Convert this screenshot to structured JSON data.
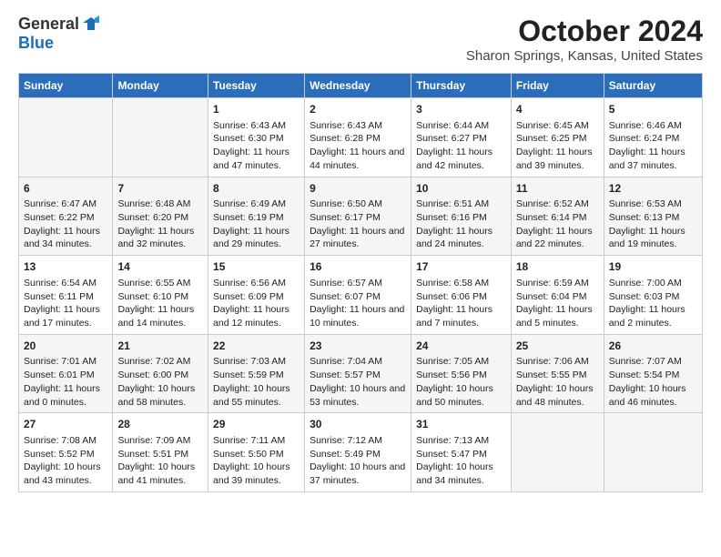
{
  "header": {
    "logo_general": "General",
    "logo_blue": "Blue",
    "month": "October 2024",
    "location": "Sharon Springs, Kansas, United States"
  },
  "days_of_week": [
    "Sunday",
    "Monday",
    "Tuesday",
    "Wednesday",
    "Thursday",
    "Friday",
    "Saturday"
  ],
  "weeks": [
    [
      {
        "day": "",
        "info": ""
      },
      {
        "day": "",
        "info": ""
      },
      {
        "day": "1",
        "info": "Sunrise: 6:43 AM\nSunset: 6:30 PM\nDaylight: 11 hours and 47 minutes."
      },
      {
        "day": "2",
        "info": "Sunrise: 6:43 AM\nSunset: 6:28 PM\nDaylight: 11 hours and 44 minutes."
      },
      {
        "day": "3",
        "info": "Sunrise: 6:44 AM\nSunset: 6:27 PM\nDaylight: 11 hours and 42 minutes."
      },
      {
        "day": "4",
        "info": "Sunrise: 6:45 AM\nSunset: 6:25 PM\nDaylight: 11 hours and 39 minutes."
      },
      {
        "day": "5",
        "info": "Sunrise: 6:46 AM\nSunset: 6:24 PM\nDaylight: 11 hours and 37 minutes."
      }
    ],
    [
      {
        "day": "6",
        "info": "Sunrise: 6:47 AM\nSunset: 6:22 PM\nDaylight: 11 hours and 34 minutes."
      },
      {
        "day": "7",
        "info": "Sunrise: 6:48 AM\nSunset: 6:20 PM\nDaylight: 11 hours and 32 minutes."
      },
      {
        "day": "8",
        "info": "Sunrise: 6:49 AM\nSunset: 6:19 PM\nDaylight: 11 hours and 29 minutes."
      },
      {
        "day": "9",
        "info": "Sunrise: 6:50 AM\nSunset: 6:17 PM\nDaylight: 11 hours and 27 minutes."
      },
      {
        "day": "10",
        "info": "Sunrise: 6:51 AM\nSunset: 6:16 PM\nDaylight: 11 hours and 24 minutes."
      },
      {
        "day": "11",
        "info": "Sunrise: 6:52 AM\nSunset: 6:14 PM\nDaylight: 11 hours and 22 minutes."
      },
      {
        "day": "12",
        "info": "Sunrise: 6:53 AM\nSunset: 6:13 PM\nDaylight: 11 hours and 19 minutes."
      }
    ],
    [
      {
        "day": "13",
        "info": "Sunrise: 6:54 AM\nSunset: 6:11 PM\nDaylight: 11 hours and 17 minutes."
      },
      {
        "day": "14",
        "info": "Sunrise: 6:55 AM\nSunset: 6:10 PM\nDaylight: 11 hours and 14 minutes."
      },
      {
        "day": "15",
        "info": "Sunrise: 6:56 AM\nSunset: 6:09 PM\nDaylight: 11 hours and 12 minutes."
      },
      {
        "day": "16",
        "info": "Sunrise: 6:57 AM\nSunset: 6:07 PM\nDaylight: 11 hours and 10 minutes."
      },
      {
        "day": "17",
        "info": "Sunrise: 6:58 AM\nSunset: 6:06 PM\nDaylight: 11 hours and 7 minutes."
      },
      {
        "day": "18",
        "info": "Sunrise: 6:59 AM\nSunset: 6:04 PM\nDaylight: 11 hours and 5 minutes."
      },
      {
        "day": "19",
        "info": "Sunrise: 7:00 AM\nSunset: 6:03 PM\nDaylight: 11 hours and 2 minutes."
      }
    ],
    [
      {
        "day": "20",
        "info": "Sunrise: 7:01 AM\nSunset: 6:01 PM\nDaylight: 11 hours and 0 minutes."
      },
      {
        "day": "21",
        "info": "Sunrise: 7:02 AM\nSunset: 6:00 PM\nDaylight: 10 hours and 58 minutes."
      },
      {
        "day": "22",
        "info": "Sunrise: 7:03 AM\nSunset: 5:59 PM\nDaylight: 10 hours and 55 minutes."
      },
      {
        "day": "23",
        "info": "Sunrise: 7:04 AM\nSunset: 5:57 PM\nDaylight: 10 hours and 53 minutes."
      },
      {
        "day": "24",
        "info": "Sunrise: 7:05 AM\nSunset: 5:56 PM\nDaylight: 10 hours and 50 minutes."
      },
      {
        "day": "25",
        "info": "Sunrise: 7:06 AM\nSunset: 5:55 PM\nDaylight: 10 hours and 48 minutes."
      },
      {
        "day": "26",
        "info": "Sunrise: 7:07 AM\nSunset: 5:54 PM\nDaylight: 10 hours and 46 minutes."
      }
    ],
    [
      {
        "day": "27",
        "info": "Sunrise: 7:08 AM\nSunset: 5:52 PM\nDaylight: 10 hours and 43 minutes."
      },
      {
        "day": "28",
        "info": "Sunrise: 7:09 AM\nSunset: 5:51 PM\nDaylight: 10 hours and 41 minutes."
      },
      {
        "day": "29",
        "info": "Sunrise: 7:11 AM\nSunset: 5:50 PM\nDaylight: 10 hours and 39 minutes."
      },
      {
        "day": "30",
        "info": "Sunrise: 7:12 AM\nSunset: 5:49 PM\nDaylight: 10 hours and 37 minutes."
      },
      {
        "day": "31",
        "info": "Sunrise: 7:13 AM\nSunset: 5:47 PM\nDaylight: 10 hours and 34 minutes."
      },
      {
        "day": "",
        "info": ""
      },
      {
        "day": "",
        "info": ""
      }
    ]
  ]
}
